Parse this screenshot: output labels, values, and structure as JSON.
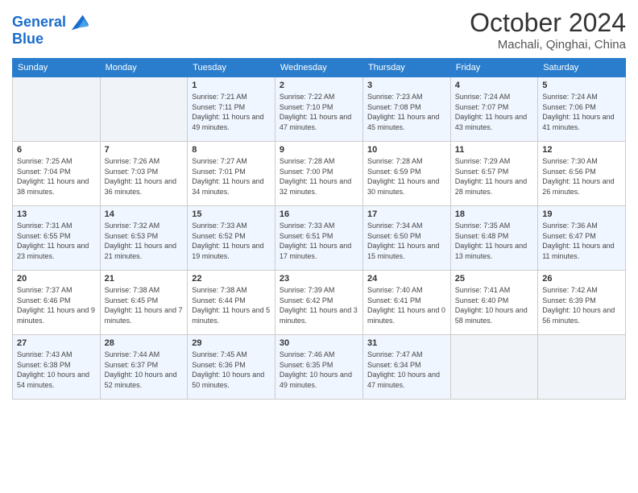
{
  "logo": {
    "line1": "General",
    "line2": "Blue"
  },
  "title": "October 2024",
  "subtitle": "Machali, Qinghai, China",
  "header_days": [
    "Sunday",
    "Monday",
    "Tuesday",
    "Wednesday",
    "Thursday",
    "Friday",
    "Saturday"
  ],
  "weeks": [
    [
      {
        "day": "",
        "info": ""
      },
      {
        "day": "",
        "info": ""
      },
      {
        "day": "1",
        "info": "Sunrise: 7:21 AM\nSunset: 7:11 PM\nDaylight: 11 hours and 49 minutes."
      },
      {
        "day": "2",
        "info": "Sunrise: 7:22 AM\nSunset: 7:10 PM\nDaylight: 11 hours and 47 minutes."
      },
      {
        "day": "3",
        "info": "Sunrise: 7:23 AM\nSunset: 7:08 PM\nDaylight: 11 hours and 45 minutes."
      },
      {
        "day": "4",
        "info": "Sunrise: 7:24 AM\nSunset: 7:07 PM\nDaylight: 11 hours and 43 minutes."
      },
      {
        "day": "5",
        "info": "Sunrise: 7:24 AM\nSunset: 7:06 PM\nDaylight: 11 hours and 41 minutes."
      }
    ],
    [
      {
        "day": "6",
        "info": "Sunrise: 7:25 AM\nSunset: 7:04 PM\nDaylight: 11 hours and 38 minutes."
      },
      {
        "day": "7",
        "info": "Sunrise: 7:26 AM\nSunset: 7:03 PM\nDaylight: 11 hours and 36 minutes."
      },
      {
        "day": "8",
        "info": "Sunrise: 7:27 AM\nSunset: 7:01 PM\nDaylight: 11 hours and 34 minutes."
      },
      {
        "day": "9",
        "info": "Sunrise: 7:28 AM\nSunset: 7:00 PM\nDaylight: 11 hours and 32 minutes."
      },
      {
        "day": "10",
        "info": "Sunrise: 7:28 AM\nSunset: 6:59 PM\nDaylight: 11 hours and 30 minutes."
      },
      {
        "day": "11",
        "info": "Sunrise: 7:29 AM\nSunset: 6:57 PM\nDaylight: 11 hours and 28 minutes."
      },
      {
        "day": "12",
        "info": "Sunrise: 7:30 AM\nSunset: 6:56 PM\nDaylight: 11 hours and 26 minutes."
      }
    ],
    [
      {
        "day": "13",
        "info": "Sunrise: 7:31 AM\nSunset: 6:55 PM\nDaylight: 11 hours and 23 minutes."
      },
      {
        "day": "14",
        "info": "Sunrise: 7:32 AM\nSunset: 6:53 PM\nDaylight: 11 hours and 21 minutes."
      },
      {
        "day": "15",
        "info": "Sunrise: 7:33 AM\nSunset: 6:52 PM\nDaylight: 11 hours and 19 minutes."
      },
      {
        "day": "16",
        "info": "Sunrise: 7:33 AM\nSunset: 6:51 PM\nDaylight: 11 hours and 17 minutes."
      },
      {
        "day": "17",
        "info": "Sunrise: 7:34 AM\nSunset: 6:50 PM\nDaylight: 11 hours and 15 minutes."
      },
      {
        "day": "18",
        "info": "Sunrise: 7:35 AM\nSunset: 6:48 PM\nDaylight: 11 hours and 13 minutes."
      },
      {
        "day": "19",
        "info": "Sunrise: 7:36 AM\nSunset: 6:47 PM\nDaylight: 11 hours and 11 minutes."
      }
    ],
    [
      {
        "day": "20",
        "info": "Sunrise: 7:37 AM\nSunset: 6:46 PM\nDaylight: 11 hours and 9 minutes."
      },
      {
        "day": "21",
        "info": "Sunrise: 7:38 AM\nSunset: 6:45 PM\nDaylight: 11 hours and 7 minutes."
      },
      {
        "day": "22",
        "info": "Sunrise: 7:38 AM\nSunset: 6:44 PM\nDaylight: 11 hours and 5 minutes."
      },
      {
        "day": "23",
        "info": "Sunrise: 7:39 AM\nSunset: 6:42 PM\nDaylight: 11 hours and 3 minutes."
      },
      {
        "day": "24",
        "info": "Sunrise: 7:40 AM\nSunset: 6:41 PM\nDaylight: 11 hours and 0 minutes."
      },
      {
        "day": "25",
        "info": "Sunrise: 7:41 AM\nSunset: 6:40 PM\nDaylight: 10 hours and 58 minutes."
      },
      {
        "day": "26",
        "info": "Sunrise: 7:42 AM\nSunset: 6:39 PM\nDaylight: 10 hours and 56 minutes."
      }
    ],
    [
      {
        "day": "27",
        "info": "Sunrise: 7:43 AM\nSunset: 6:38 PM\nDaylight: 10 hours and 54 minutes."
      },
      {
        "day": "28",
        "info": "Sunrise: 7:44 AM\nSunset: 6:37 PM\nDaylight: 10 hours and 52 minutes."
      },
      {
        "day": "29",
        "info": "Sunrise: 7:45 AM\nSunset: 6:36 PM\nDaylight: 10 hours and 50 minutes."
      },
      {
        "day": "30",
        "info": "Sunrise: 7:46 AM\nSunset: 6:35 PM\nDaylight: 10 hours and 49 minutes."
      },
      {
        "day": "31",
        "info": "Sunrise: 7:47 AM\nSunset: 6:34 PM\nDaylight: 10 hours and 47 minutes."
      },
      {
        "day": "",
        "info": ""
      },
      {
        "day": "",
        "info": ""
      }
    ]
  ]
}
